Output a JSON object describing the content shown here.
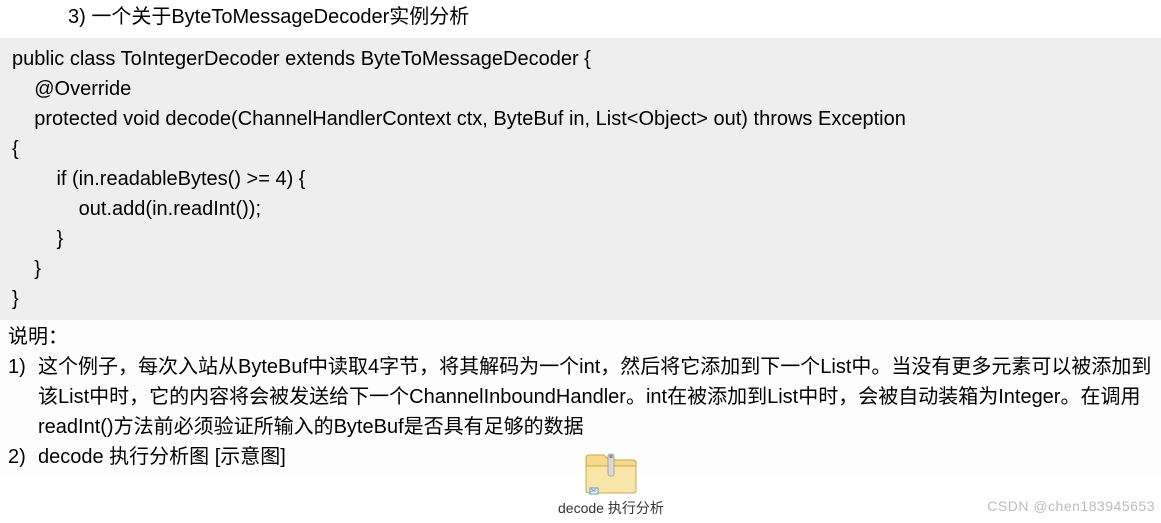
{
  "heading": "3)   一个关于ByteToMessageDecoder实例分析",
  "code": {
    "l1": "public class ToIntegerDecoder extends ByteToMessageDecoder {",
    "l2": "    @Override",
    "l3": "    protected void decode(ChannelHandlerContext ctx, ByteBuf in, List<Object> out) throws Exception",
    "l4": "{",
    "l5": "        if (in.readableBytes() >= 4) {",
    "l6": "            out.add(in.readInt());",
    "l7": "        }",
    "l8": "    }",
    "l9": "}"
  },
  "explain": {
    "title": "说明：",
    "item1_num": "1)",
    "item1_text": "这个例子，每次入站从ByteBuf中读取4字节，将其解码为一个int，然后将它添加到下一个List中。当没有更多元素可以被添加到该List中时，它的内容将会被发送给下一个ChannelInboundHandler。int在被添加到List中时，会被自动装箱为Integer。在调用readInt()方法前必须验证所输入的ByteBuf是否具有足够的数据",
    "item2_num": "2)",
    "item2_text": "decode 执行分析图 [示意图]"
  },
  "folder_label": "decode 执行分析",
  "watermark": "CSDN @chen183945653"
}
